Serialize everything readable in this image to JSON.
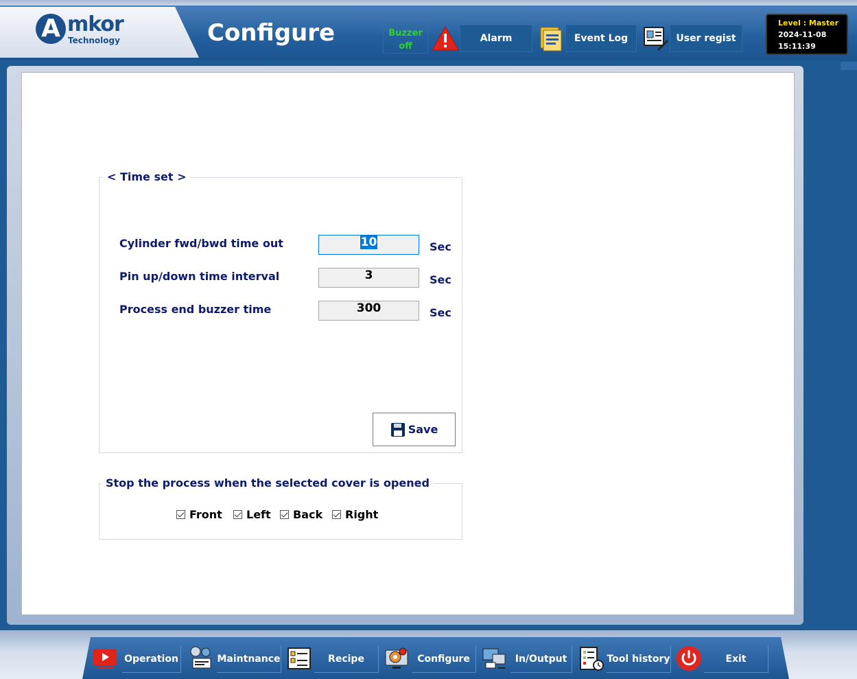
{
  "header": {
    "logo_initial": "A",
    "logo_text": "mkor",
    "logo_sub": "Technology",
    "page_title": "Configure",
    "buzzer": {
      "line1": "Buzzer",
      "line2": "off",
      "color": "#2ed12e"
    },
    "buttons": {
      "alarm": "Alarm",
      "event_log": "Event Log",
      "user_regist": "User regist"
    },
    "status": {
      "level": "Level : Master",
      "date": "2024-11-08",
      "time": "15:11:39"
    }
  },
  "time_set": {
    "title": "< Time set >",
    "rows": [
      {
        "label": "Cylinder fwd/bwd time out",
        "value": "10",
        "unit": "Sec"
      },
      {
        "label": "Pin up/down time interval",
        "value": "3",
        "unit": "Sec"
      },
      {
        "label": "Process end buzzer time",
        "value": "300",
        "unit": "Sec"
      }
    ],
    "save_label": "Save"
  },
  "cover": {
    "title": "Stop the process when the selected cover is opened",
    "options": [
      {
        "label": "Front",
        "checked": true
      },
      {
        "label": "Left",
        "checked": true
      },
      {
        "label": "Back",
        "checked": true
      },
      {
        "label": "Right",
        "checked": true
      }
    ]
  },
  "nav": {
    "operation": "Operation",
    "maintenance": "Maintnance",
    "recipe": "Recipe",
    "configure": "Configure",
    "inoutput": "In/Output",
    "tool_history": "Tool history",
    "exit": "Exit"
  },
  "colors": {
    "brand_blue": "#1e5a94",
    "label_navy": "#0d1a6e",
    "level_yellow": "#ffe300",
    "alarm_red": "#e2231a",
    "exit_red": "#e0261e"
  }
}
